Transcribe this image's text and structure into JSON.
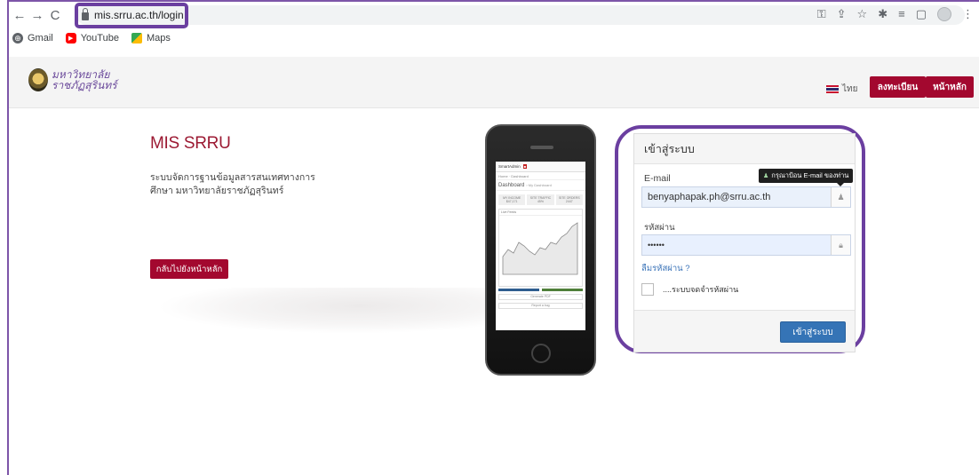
{
  "browser": {
    "url": "mis.srru.ac.th/login",
    "nav": {
      "back": "←",
      "forward": "→",
      "reload": "C"
    },
    "toolbar_icons": [
      "key-icon",
      "share-icon",
      "star-icon",
      "extensions-icon",
      "reading-list-icon",
      "side-panel-icon",
      "profile-avatar"
    ],
    "bookmarks": [
      {
        "label": "Gmail",
        "icon": "gmail-icon"
      },
      {
        "label": "YouTube",
        "icon": "youtube-icon"
      },
      {
        "label": "Maps",
        "icon": "maps-icon"
      }
    ],
    "highlight_color": "#6b3fa0"
  },
  "header": {
    "logo_line1": "มหาวิทยาลัย",
    "logo_line2": "ราชภัฏสุรินทร์",
    "language": "ไทย",
    "register_label": "ลงทะเบียน",
    "home_label": "หน้าหลัก",
    "accent_color": "#a3082f"
  },
  "intro": {
    "title": "MIS SRRU",
    "description": "ระบบจัดการฐานข้อมูลสารสนเทศทางการศึกษา มหาวิทยาลัยราชภัฏสุรินทร์",
    "back_button": "กลับไปยังหน้าหลัก"
  },
  "phone_screen": {
    "app_name": "SmartAdmin",
    "breadcrumb": "Home · Dashboard",
    "dashboard": "Dashboard",
    "dashboard_sub": "› My Dashboard",
    "stats": [
      "MY INCOME $47,171",
      "SITE TRAFFIC 45%",
      "SITE ORDERS 2447"
    ],
    "chart_title": "Live Feeds",
    "buttons": [
      "Generate PDF",
      "Report a bug"
    ]
  },
  "login": {
    "heading": "เข้าสู่ระบบ",
    "email_label": "E-mail",
    "email_tooltip": "กรุณาป้อน E-mail ของท่าน",
    "email_value": "benyaphapak.ph@srru.ac.th",
    "password_label": "รหัสผ่าน",
    "password_value": "••••••",
    "forgot_label": "ลืมรหัสผ่าน ?",
    "remember_label": "....ระบบจดจำรหัสผ่าน",
    "submit_label": "เข้าสู่ระบบ",
    "button_color": "#3574b6"
  }
}
